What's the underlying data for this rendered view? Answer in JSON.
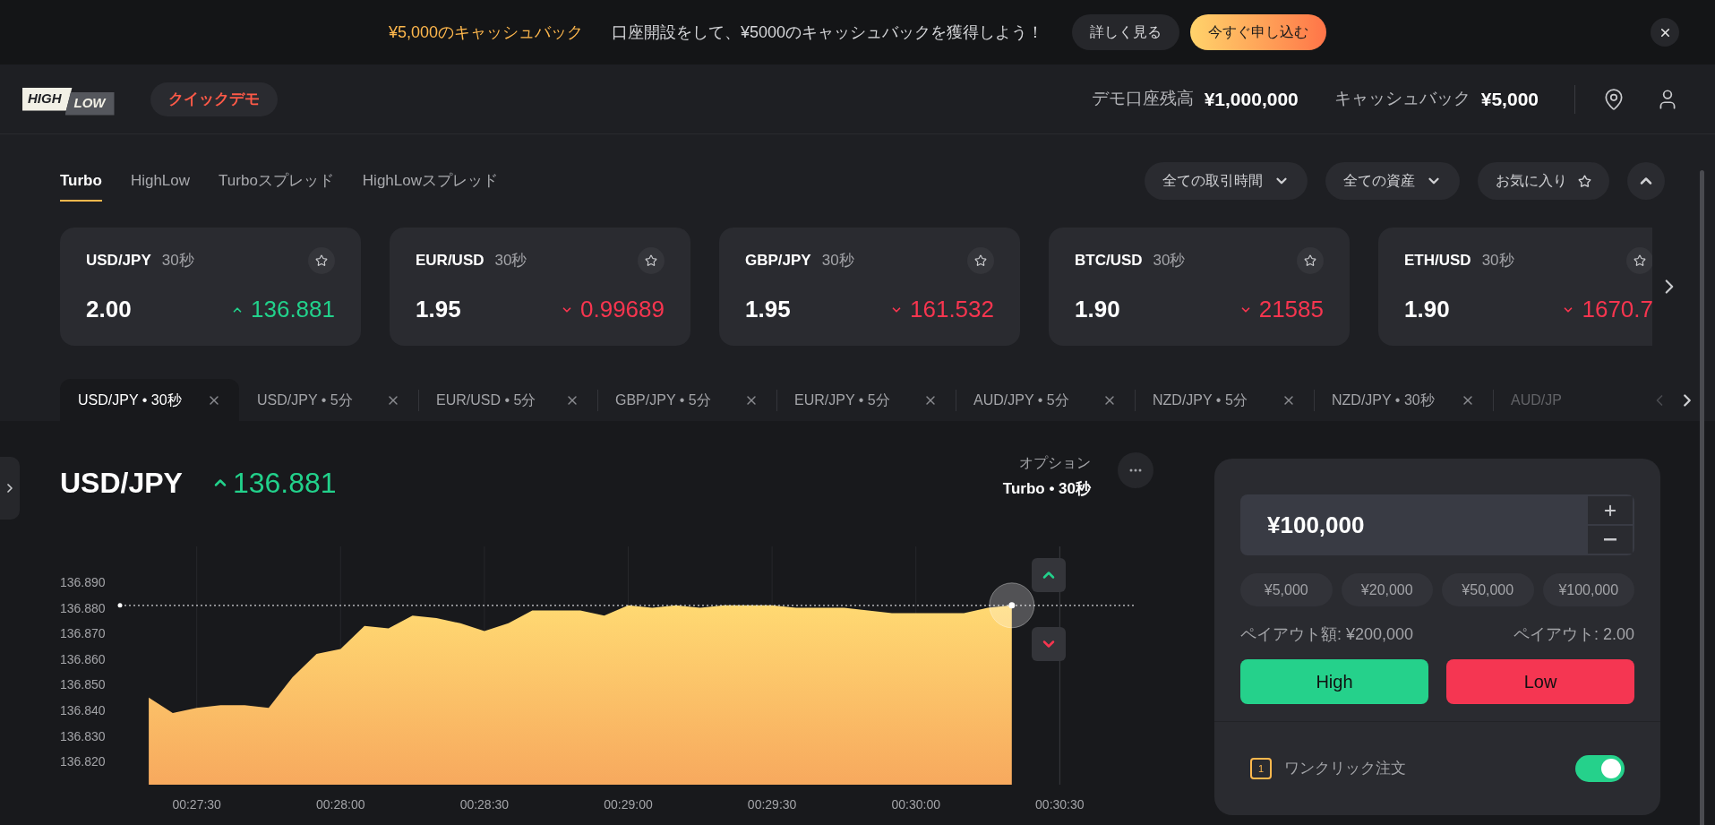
{
  "banner": {
    "headline": "¥5,000のキャッシュバック",
    "message": "口座開設をして、¥5000のキャッシュバックを獲得しよう！",
    "buttons": [
      {
        "label": "詳しく見る",
        "kind": "secondary"
      },
      {
        "label": "今すぐ申し込む",
        "kind": "primary"
      }
    ]
  },
  "header": {
    "logo": {
      "top": "HIGH",
      "bottom": "LOW"
    },
    "mode_badge": "クイックデモ",
    "balances": [
      {
        "label": "デモ口座残高",
        "value": "¥1,000,000"
      },
      {
        "label": "キャッシュバック",
        "value": "¥5,000"
      }
    ]
  },
  "product_tabs": [
    {
      "label": "Turbo",
      "selected": true
    },
    {
      "label": "HighLow",
      "selected": false
    },
    {
      "label": "Turboスプレッド",
      "selected": false
    },
    {
      "label": "HighLowスプレッド",
      "selected": false
    }
  ],
  "filters": [
    {
      "label": "全ての取引時間",
      "kind": "dropdown"
    },
    {
      "label": "全ての資産",
      "kind": "dropdown"
    },
    {
      "label": "お気に入り",
      "kind": "favorite"
    }
  ],
  "asset_cards": [
    {
      "pair": "USD/JPY",
      "duration": "30秒",
      "payout": "2.00",
      "price": "136.881",
      "rising": true
    },
    {
      "pair": "EUR/USD",
      "duration": "30秒",
      "payout": "1.95",
      "price": "0.99689",
      "rising": false
    },
    {
      "pair": "GBP/JPY",
      "duration": "30秒",
      "payout": "1.95",
      "price": "161.532",
      "rising": false
    },
    {
      "pair": "BTC/USD",
      "duration": "30秒",
      "payout": "1.90",
      "price": "21585",
      "rising": false
    },
    {
      "pair": "ETH/USD",
      "duration": "30秒",
      "payout": "1.90",
      "price": "1670.7",
      "rising": false
    }
  ],
  "chart_tabs": [
    {
      "label": "USD/JPY • 30秒",
      "selected": true,
      "closable": true
    },
    {
      "label": "USD/JPY • 5分",
      "selected": false,
      "closable": true
    },
    {
      "label": "EUR/USD • 5分",
      "selected": false,
      "closable": true
    },
    {
      "label": "GBP/JPY • 5分",
      "selected": false,
      "closable": true
    },
    {
      "label": "EUR/JPY • 5分",
      "selected": false,
      "closable": true
    },
    {
      "label": "AUD/JPY • 5分",
      "selected": false,
      "closable": true
    },
    {
      "label": "NZD/JPY • 5分",
      "selected": false,
      "closable": true
    },
    {
      "label": "NZD/JPY • 30秒",
      "selected": false,
      "closable": true
    },
    {
      "label": "AUD/JP",
      "selected": false,
      "closable": false
    }
  ],
  "chart": {
    "pair": "USD/JPY",
    "price": "136.881",
    "rising": true,
    "option_label": "オプション",
    "option_value": "Turbo • 30秒",
    "chart_data": {
      "type": "area",
      "categories": [
        null,
        null,
        null,
        "00:27:30",
        null,
        null,
        null,
        null,
        null,
        "00:28:00",
        null,
        null,
        null,
        null,
        null,
        "00:28:30",
        null,
        null,
        null,
        null,
        null,
        "00:29:00",
        null,
        null,
        null,
        null,
        null,
        "00:29:30",
        null,
        null,
        null,
        null,
        null,
        "00:30:00",
        null,
        null,
        null,
        null,
        null,
        "00:30:30",
        null,
        null,
        null
      ],
      "values": [
        null,
        136.845,
        136.839,
        136.841,
        136.842,
        136.842,
        136.841,
        136.853,
        136.862,
        136.864,
        136.873,
        136.872,
        136.877,
        136.876,
        136.874,
        136.871,
        136.874,
        136.879,
        136.879,
        136.879,
        136.877,
        136.881,
        136.88,
        136.881,
        136.88,
        136.881,
        136.881,
        136.881,
        136.88,
        136.88,
        136.88,
        136.879,
        136.878,
        136.878,
        136.878,
        136.878,
        136.88,
        136.881,
        null,
        null,
        null,
        null,
        null
      ],
      "ylim": [
        136.811,
        136.904
      ],
      "grid": true,
      "ref_lines": [
        {
          "value": 136.881,
          "axis": "y"
        }
      ],
      "yticks": [
        {
          "value": 136.82,
          "label": "136.820"
        },
        {
          "value": 136.83,
          "label": "136.830"
        },
        {
          "value": 136.84,
          "label": "136.840"
        },
        {
          "value": 136.85,
          "label": "136.850"
        },
        {
          "value": 136.86,
          "label": "136.860"
        },
        {
          "value": 136.87,
          "label": "136.870"
        },
        {
          "value": 136.88,
          "label": "136.880"
        },
        {
          "value": 136.89,
          "label": "136.890"
        }
      ]
    }
  },
  "trade_panel": {
    "amount": "¥100,000",
    "quick_amounts": [
      "¥5,000",
      "¥20,000",
      "¥50,000",
      "¥100,000"
    ],
    "payout_amount": "ペイアウト額: ¥200,000",
    "payout_rate": "ペイアウト: 2.00",
    "buttons": [
      {
        "label": "High",
        "kind": "high"
      },
      {
        "label": "Low",
        "kind": "low"
      }
    ],
    "one_click": {
      "badge": "1",
      "label": "ワンクリック注文",
      "on": true
    }
  }
}
